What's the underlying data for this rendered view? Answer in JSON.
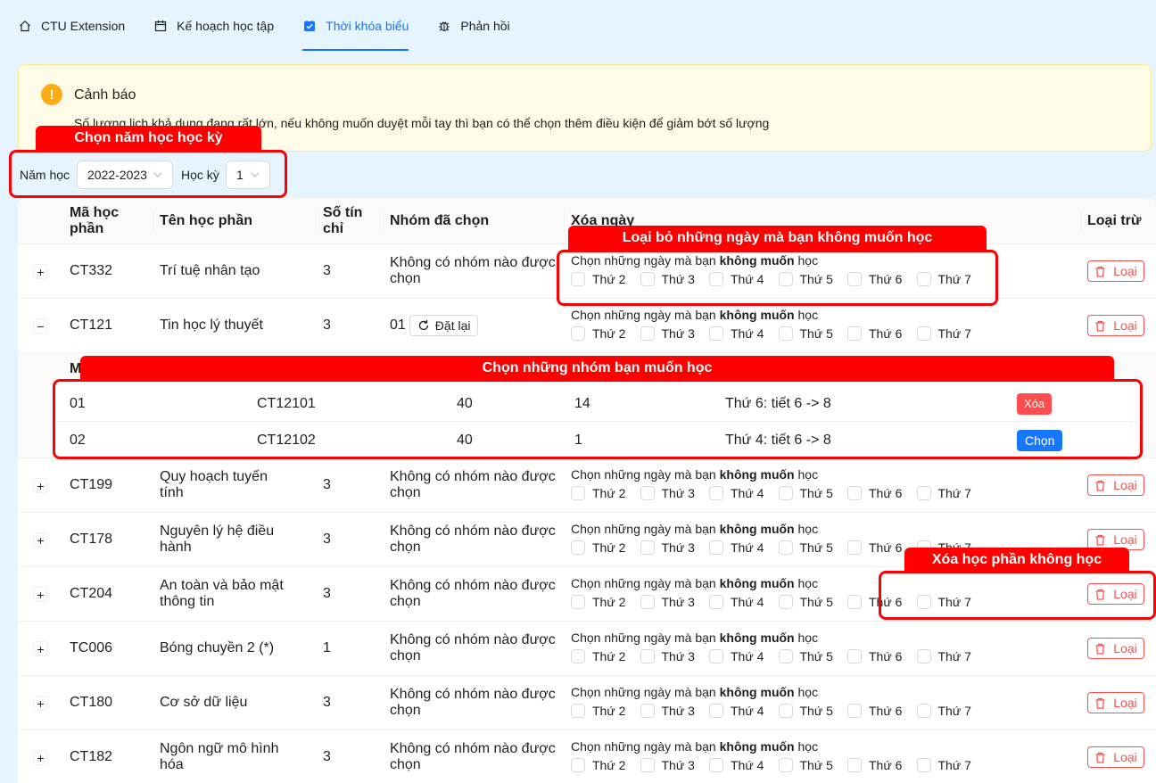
{
  "tabs": [
    {
      "label": "CTU Extension",
      "icon": "home-icon"
    },
    {
      "label": "Kế hoạch học tập",
      "icon": "calendar-icon"
    },
    {
      "label": "Thời khóa biểu",
      "icon": "checkbox-icon",
      "active": true
    },
    {
      "label": "Phản hồi",
      "icon": "bug-icon"
    }
  ],
  "alert": {
    "title": "Cảnh báo",
    "description": "Số lượng lịch khả dụng đang rất lớn, nếu không muốn duyệt mỗi tay thì bạn có thể chọn thêm điều kiện để giảm bớt số lượng"
  },
  "filters": {
    "year_label": "Năm học",
    "year_value": "2022-2023",
    "term_label": "Học kỳ",
    "term_value": "1"
  },
  "table": {
    "headers": {
      "code": "Mã học phần",
      "name": "Tên học phần",
      "credits": "Số tín chỉ",
      "group": "Nhóm đã chọn",
      "remove_days": "Xóa ngày",
      "exclude": "Loại trừ"
    },
    "days_prompt_prefix": "Chọn những ngày mà bạn",
    "days_prompt_bold": "không muốn",
    "days_prompt_suffix": "học",
    "days": [
      "Thứ 2",
      "Thứ 3",
      "Thứ 4",
      "Thứ 5",
      "Thứ 6",
      "Thứ 7"
    ],
    "exclude_label": "Loại",
    "reset_label": "Đặt lại",
    "rows": [
      {
        "code": "CT332",
        "name": "Trí tuệ nhân tạo",
        "credits": "3",
        "group": "Không có nhóm nào được chọn",
        "expander": "+"
      },
      {
        "code": "CT121",
        "name": "Tin học lý thuyết",
        "credits": "3",
        "group": "01",
        "expander": "−"
      },
      {
        "code": "CT199",
        "name": "Quy hoạch tuyến tính",
        "credits": "3",
        "group": "Không có nhóm nào được chọn",
        "expander": "+"
      },
      {
        "code": "CT178",
        "name": "Nguyên lý hệ điều hành",
        "credits": "3",
        "group": "Không có nhóm nào được chọn",
        "expander": "+"
      },
      {
        "code": "CT204",
        "name": "An toàn và bảo mật thông tin",
        "credits": "3",
        "group": "Không có nhóm nào được chọn",
        "expander": "+"
      },
      {
        "code": "TC006",
        "name": "Bóng chuyền 2 (*)",
        "credits": "1",
        "group": "Không có nhóm nào được chọn",
        "expander": "+"
      },
      {
        "code": "CT180",
        "name": "Cơ sở dữ liệu",
        "credits": "3",
        "group": "Không có nhóm nào được chọn",
        "expander": "+"
      },
      {
        "code": "CT182",
        "name": "Ngôn ngữ mô hình hóa",
        "credits": "3",
        "group": "Không có nhóm nào được chọn",
        "expander": "+"
      }
    ]
  },
  "groups": {
    "header_letter": "M",
    "rows": [
      {
        "group": "01",
        "class_code": "CT12101",
        "capacity": "40",
        "remaining": "14",
        "schedule": "Thứ 6: tiết 6 -> 8",
        "action": "Xóa",
        "action_type": "delete"
      },
      {
        "group": "02",
        "class_code": "CT12102",
        "capacity": "40",
        "remaining": "1",
        "schedule": "Thứ 4: tiết 6 -> 8",
        "action": "Chọn",
        "action_type": "pick"
      }
    ]
  },
  "annotations": {
    "year_term": "Chọn năm học học kỳ",
    "remove_days": "Loại bỏ những ngày mà bạn không muốn học",
    "pick_groups": "Chọn những nhóm bạn muốn học",
    "exclude_course": "Xóa học phần không học"
  },
  "colors": {
    "accent": "#1677ff",
    "danger": "#ff4d4f",
    "annotation": "#ff0000",
    "warning": "#faad14",
    "page_bg": "#e6f4ff"
  }
}
